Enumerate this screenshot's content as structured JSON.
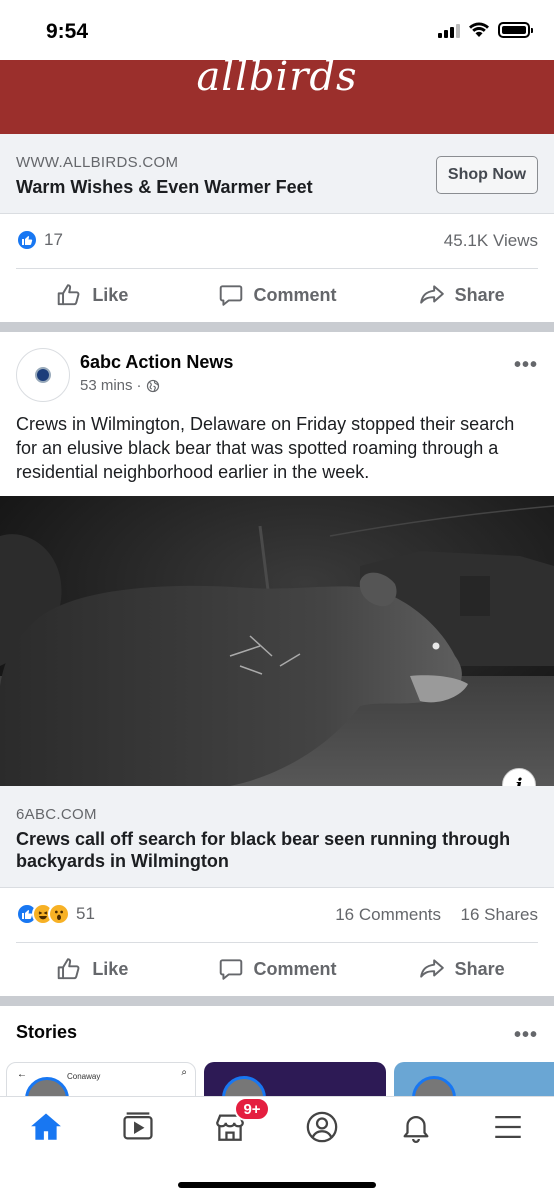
{
  "status_bar": {
    "time": "9:54"
  },
  "ad": {
    "brand_logo": "allbirds",
    "domain": "WWW.ALLBIRDS.COM",
    "headline": "Warm Wishes & Even Warmer Feet",
    "cta_label": "Shop Now",
    "reaction_count": "17",
    "views": "45.1K Views"
  },
  "actions": {
    "like": "Like",
    "comment": "Comment",
    "share": "Share"
  },
  "post": {
    "author": "6abc Action News",
    "time": "53 mins",
    "text": "Crews in Wilmington, Delaware on Friday stopped their search for an elusive black bear that was spotted roaming through a residential neighborhood earlier in the week.",
    "link_domain": "6ABC.COM",
    "link_title": "Crews call off search for black bear seen running through backyards in Wilmington",
    "reaction_count": "51",
    "comments": "16 Comments",
    "shares": "16 Shares"
  },
  "stories": {
    "title": "Stories",
    "items": [
      {
        "label": "Conaway"
      }
    ]
  },
  "tab_bar": {
    "tabs": [
      "home",
      "watch",
      "marketplace",
      "profile",
      "notifications",
      "menu"
    ],
    "marketplace_badge": "9+"
  },
  "colors": {
    "accent": "#1877f2",
    "ad_banner": "#9b2f2c",
    "badge": "#e41e3f",
    "secondary_text": "#65676b"
  }
}
